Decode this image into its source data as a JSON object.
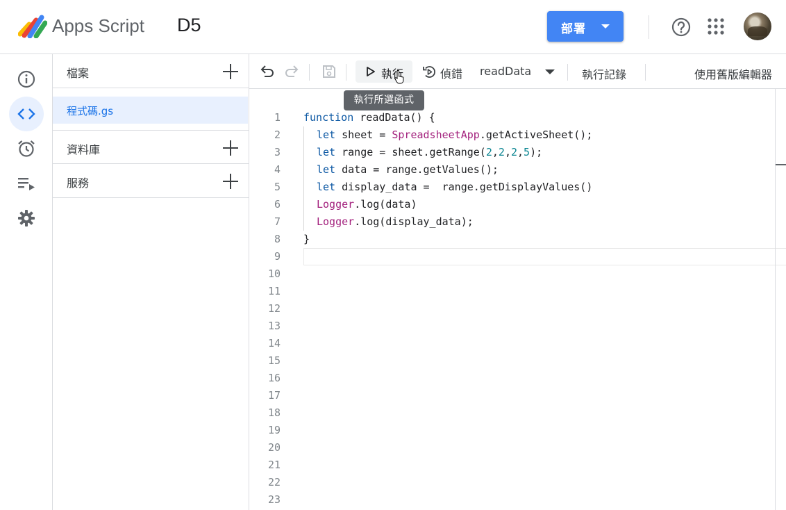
{
  "header": {
    "app_name": "Apps Script",
    "project_name": "D5",
    "deploy_label": "部署"
  },
  "sidebar": {
    "sections": [
      {
        "title": "檔案"
      },
      {
        "title": "資料庫"
      },
      {
        "title": "服務"
      }
    ],
    "files": [
      {
        "label": "程式碼.gs"
      }
    ]
  },
  "toolbar": {
    "run_label": "執行",
    "debug_label": "偵錯",
    "function_name": "readData",
    "log_label": "執行記錄",
    "legacy_label": "使用舊版編輯器",
    "run_tooltip": "執行所選函式"
  },
  "editor": {
    "line_numbers": [
      "1",
      "2",
      "3",
      "4",
      "5",
      "6",
      "7",
      "8",
      "9",
      "10",
      "11",
      "12",
      "13",
      "14",
      "15",
      "16",
      "17",
      "18",
      "19",
      "20",
      "21",
      "22",
      "23"
    ],
    "code": [
      [
        {
          "t": "function",
          "c": "kw"
        },
        {
          "t": " readData() {",
          "c": ""
        }
      ],
      [
        {
          "t": "let",
          "c": "kw"
        },
        {
          "t": " sheet = ",
          "c": ""
        },
        {
          "t": "SpreadsheetApp",
          "c": "cls"
        },
        {
          "t": ".getActiveSheet();",
          "c": ""
        }
      ],
      [
        {
          "t": "let",
          "c": "kw"
        },
        {
          "t": " range = sheet.getRange(",
          "c": ""
        },
        {
          "t": "2",
          "c": "num"
        },
        {
          "t": ",",
          "c": ""
        },
        {
          "t": "2",
          "c": "num"
        },
        {
          "t": ",",
          "c": ""
        },
        {
          "t": "2",
          "c": "num"
        },
        {
          "t": ",",
          "c": ""
        },
        {
          "t": "5",
          "c": "num"
        },
        {
          "t": ");",
          "c": ""
        }
      ],
      [
        {
          "t": "let",
          "c": "kw"
        },
        {
          "t": " data = range.getValues();",
          "c": ""
        }
      ],
      [
        {
          "t": "let",
          "c": "kw"
        },
        {
          "t": " display_data =  range.getDisplayValues()",
          "c": ""
        }
      ],
      [
        {
          "t": "Logger",
          "c": "cls"
        },
        {
          "t": ".log(data)",
          "c": ""
        }
      ],
      [
        {
          "t": "Logger",
          "c": "cls"
        },
        {
          "t": ".log(display_data);",
          "c": ""
        }
      ],
      [
        {
          "t": "}",
          "c": ""
        }
      ],
      []
    ]
  },
  "colors": {
    "accent": "#4285f4",
    "selected_bg": "#e8f0fe",
    "keyword": "#0b57a3",
    "class": "#a3217d",
    "number": "#098591"
  }
}
